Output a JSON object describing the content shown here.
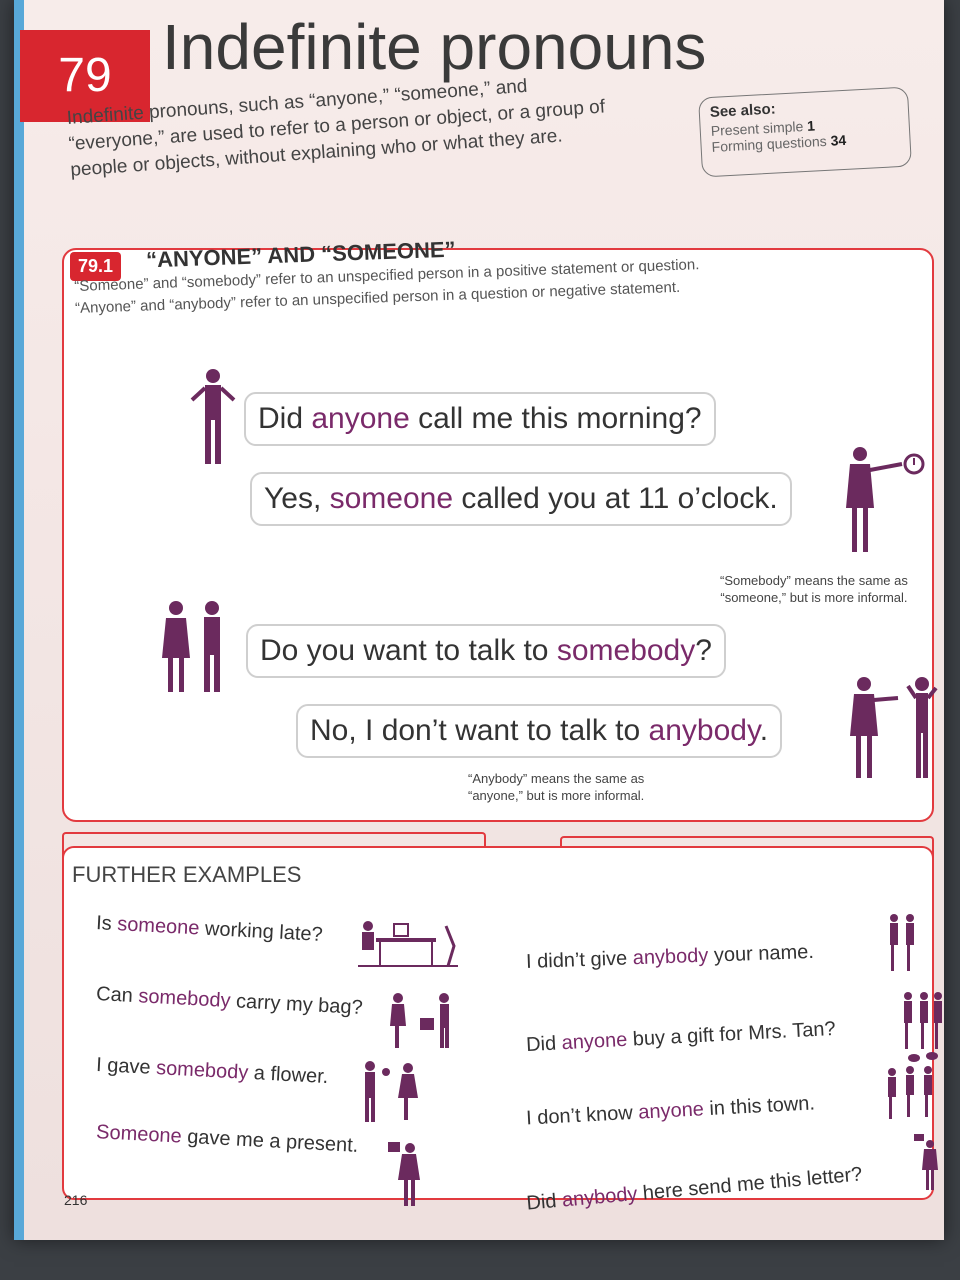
{
  "chapter": {
    "number": "79",
    "title": "Indefinite pronouns",
    "intro": "Indefinite pronouns, such as “anyone,” “someone,” and “everyone,” are used to refer to a person or object, or a group of people or objects, without explaining who or what they are."
  },
  "see_also": {
    "heading": "See also:",
    "items": [
      {
        "label": "Present simple",
        "page": "1"
      },
      {
        "label": "Forming questions",
        "page": "34"
      }
    ]
  },
  "section": {
    "number": "79.1",
    "title": "“ANYONE” AND “SOMEONE”",
    "desc_line1": "“Someone” and “somebody” refer to an unspecified person in a positive statement or question.",
    "desc_line2": "“Anyone” and “anybody” refer to an unspecified person in a question or negative statement."
  },
  "dialog": [
    {
      "pre": "Did ",
      "hl": "anyone",
      "post": " call me this morning?"
    },
    {
      "pre": "Yes, ",
      "hl": "someone",
      "post": " called you at 11 o’clock."
    },
    {
      "pre": "Do you want to talk to ",
      "hl": "somebody",
      "post": "?"
    },
    {
      "pre": "No, I don’t want to talk to ",
      "hl": "anybody",
      "post": "."
    }
  ],
  "notes": {
    "somebody": [
      "“Somebody” means the same as",
      "“someone,” but is more informal."
    ],
    "anybody": [
      "“Anybody” means the same as",
      "“anyone,” but is more informal."
    ]
  },
  "further": {
    "title": "FURTHER EXAMPLES",
    "left": [
      {
        "pre": "Is ",
        "hl": "someone",
        "post": " working late?"
      },
      {
        "pre": "Can ",
        "hl": "somebody",
        "post": " carry my bag?"
      },
      {
        "pre": "I gave ",
        "hl": "somebody",
        "post": " a flower."
      },
      {
        "pre": "",
        "hl": "Someone",
        "post": " gave me a present."
      }
    ],
    "right": [
      {
        "pre": "I didn’t give ",
        "hl": "anybody",
        "post": " your name."
      },
      {
        "pre": "Did ",
        "hl": "anyone",
        "post": " buy a gift for Mrs. Tan?"
      },
      {
        "pre": "I don’t know ",
        "hl": "anyone",
        "post": " in this town."
      },
      {
        "pre": "Did ",
        "hl": "anybody",
        "post": " here send me this letter?"
      }
    ]
  },
  "page_number": "216",
  "colors": {
    "accent": "#d8262f",
    "highlight": "#7a2a6a",
    "figure": "#6b2a5e"
  }
}
